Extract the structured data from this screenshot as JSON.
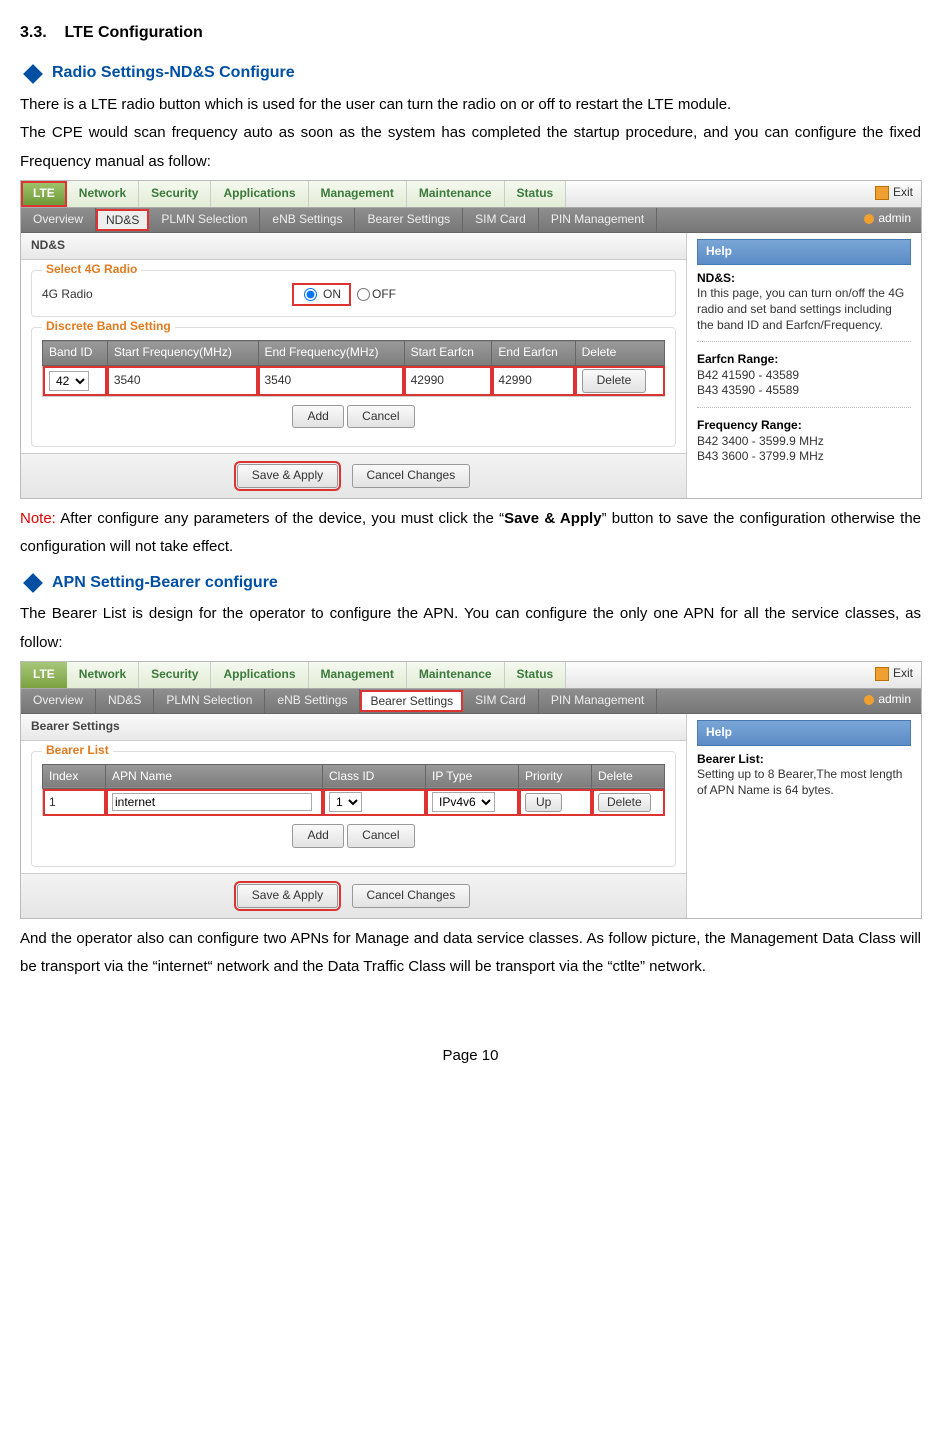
{
  "doc": {
    "section_number": "3.3.",
    "section_title": "LTE Configuration",
    "sub1_title": "Radio Settings-ND&S Configure",
    "p1": "There is a LTE radio button which is used for the user can turn the radio on or off to restart the LTE module.",
    "p2": "The CPE would scan frequency auto as soon as the system has completed the startup procedure, and you can configure the fixed Frequency manual as follow:",
    "note_label": "Note:",
    "note_rest_a": " After configure any parameters of the device, you must click the “",
    "note_bold": "Save & Apply",
    "note_rest_b": "” button to save the configuration otherwise the configuration will not take effect.",
    "sub2_title": "APN Setting-Bearer configure",
    "p3": "The Bearer List is design for the operator to configure the APN. You can configure the only one APN for all the service classes, as follow:",
    "p4": "And the operator also can configure two APNs for Manage and data service classes. As follow picture, the Management Data Class will be transport via the “internet“ network and the Data Traffic Class will be transport via the “ctlte” network.",
    "page_label": "Page 10"
  },
  "common": {
    "tabs": [
      "LTE",
      "Network",
      "Security",
      "Applications",
      "Management",
      "Maintenance",
      "Status"
    ],
    "subtabs": [
      "Overview",
      "ND&S",
      "PLMN Selection",
      "eNB Settings",
      "Bearer Settings",
      "SIM Card",
      "PIN Management"
    ],
    "exit": "Exit",
    "admin": "admin",
    "help_title": "Help",
    "save_apply": "Save & Apply",
    "cancel_changes": "Cancel Changes",
    "add": "Add",
    "cancel": "Cancel",
    "delete": "Delete"
  },
  "shot1": {
    "panel_title": "ND&S",
    "fieldset1_legend": "Select 4G Radio",
    "radio_label": "4G Radio",
    "on": "ON",
    "off": "OFF",
    "fieldset2_legend": "Discrete Band Setting",
    "cols": [
      "Band ID",
      "Start Frequency(MHz)",
      "End Frequency(MHz)",
      "Start Earfcn",
      "End Earfcn",
      "Delete"
    ],
    "row": {
      "band_id": "42",
      "start_freq": "3540",
      "end_freq": "3540",
      "start_earfcn": "42990",
      "end_earfcn": "42990"
    },
    "help": {
      "t1": "ND&S:",
      "b1": "In this page, you can turn on/off the 4G radio and set band settings including the band ID and Earfcn/Frequency.",
      "t2": "Earfcn Range:",
      "b2a": "B42 41590 - 43589",
      "b2b": "B43 43590 - 45589",
      "t3": "Frequency Range:",
      "b3a": "B42 3400 - 3599.9 MHz",
      "b3b": "B43 3600 - 3799.9 MHz"
    }
  },
  "shot2": {
    "panel_title": "Bearer Settings",
    "fieldset_legend": "Bearer List",
    "cols": [
      "Index",
      "APN Name",
      "Class ID",
      "IP Type",
      "Priority",
      "Delete"
    ],
    "row": {
      "index": "1",
      "apn": "internet",
      "class_id": "1",
      "ip_type": "IPv4v6",
      "priority": "Up"
    },
    "help": {
      "t1": "Bearer List:",
      "b1": "Setting up to 8 Bearer,The most length of APN Name is 64 bytes."
    }
  }
}
